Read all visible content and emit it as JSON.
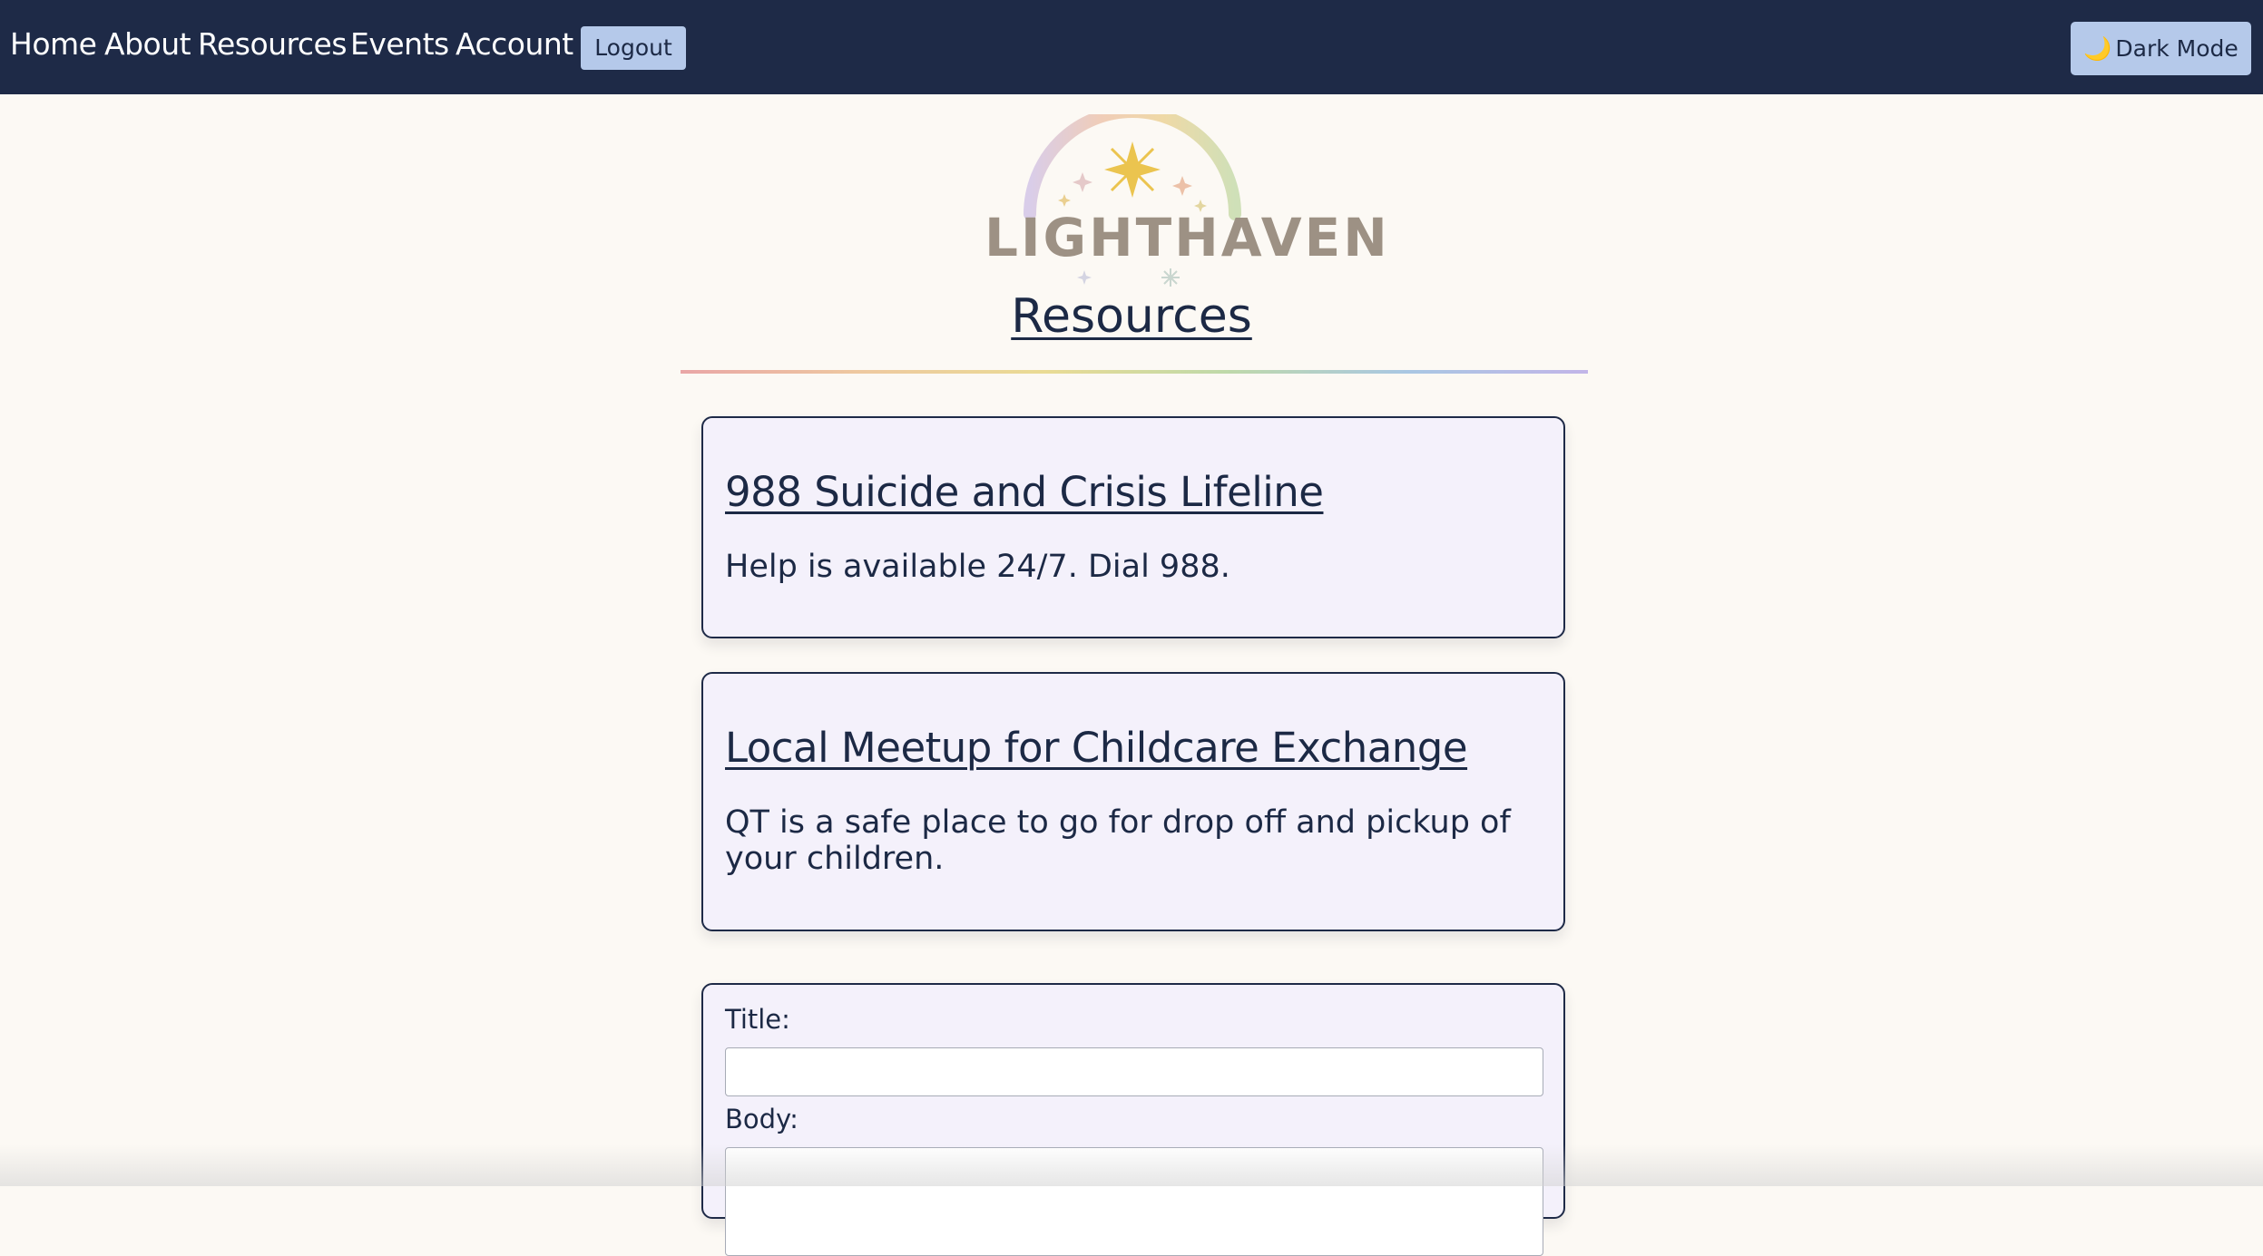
{
  "nav": {
    "links": [
      "Home",
      "About",
      "Resources",
      "Events",
      "Account"
    ],
    "logout_label": "Logout",
    "dark_mode_label": "Dark Mode",
    "dark_mode_icon": "🌙"
  },
  "logo": {
    "text": "LIGHTHAVEN"
  },
  "page": {
    "title": "Resources"
  },
  "resources": [
    {
      "title": "988 Suicide and Crisis Lifeline",
      "body": "Help is available 24/7. Dial 988."
    },
    {
      "title": "Local Meetup for Childcare Exchange",
      "body": "QT is a safe place to go for drop off and pickup of your children."
    }
  ],
  "form": {
    "title_label": "Title:",
    "title_value": "",
    "body_label": "Body:",
    "body_value": ""
  },
  "colors": {
    "navbar": "#1e2a47",
    "button": "#b5c9ea",
    "page_bg": "#fcf9f4",
    "card_bg": "#f4f1fb",
    "text": "#1c2945"
  }
}
